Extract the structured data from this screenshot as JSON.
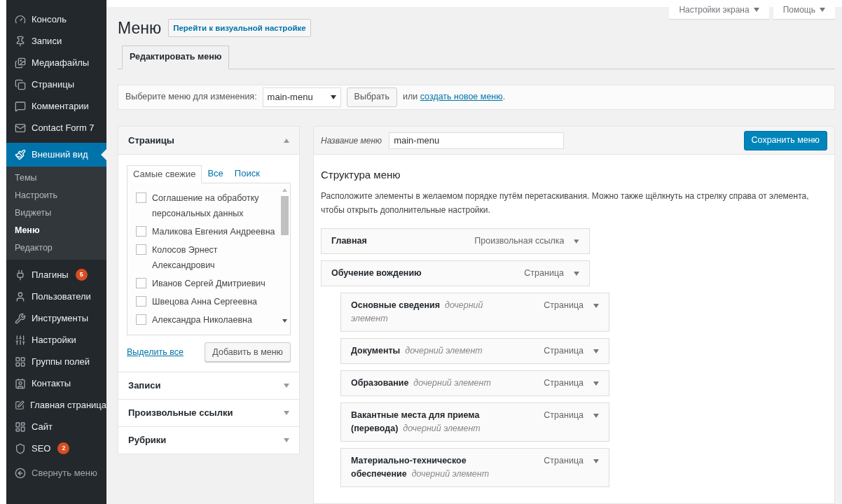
{
  "sidebar": {
    "items": [
      {
        "label": "Консоль",
        "selected": false
      },
      {
        "label": "Записи",
        "selected": false
      },
      {
        "label": "Медиафайлы",
        "selected": false
      },
      {
        "label": "Страницы",
        "selected": false
      },
      {
        "label": "Комментарии",
        "selected": false
      },
      {
        "label": "Contact Form 7",
        "selected": false
      },
      {
        "label": "Внешний вид",
        "selected": true,
        "children": [
          {
            "label": "Темы",
            "selected": false
          },
          {
            "label": "Настроить",
            "selected": false
          },
          {
            "label": "Виджеты",
            "selected": false
          },
          {
            "label": "Меню",
            "selected": true
          },
          {
            "label": "Редактор",
            "selected": false
          }
        ]
      },
      {
        "label": "Плагины",
        "selected": false,
        "badge": "5"
      },
      {
        "label": "Пользователи",
        "selected": false
      },
      {
        "label": "Инструменты",
        "selected": false
      },
      {
        "label": "Настройки",
        "selected": false
      },
      {
        "label": "Группы полей",
        "selected": false
      },
      {
        "label": "Контакты",
        "selected": false
      },
      {
        "label": "Главная страница",
        "selected": false
      },
      {
        "label": "Сайт",
        "selected": false
      },
      {
        "label": "SEO",
        "selected": false,
        "badge": "2"
      }
    ],
    "collapse": "Свернуть меню"
  },
  "top_buttons": [
    "Настройки экрана",
    "Помощь"
  ],
  "page": {
    "title": "Меню",
    "action": "Перейти к визуальной настройке"
  },
  "tabs": [
    {
      "label": "Редактировать меню",
      "selected": true
    }
  ],
  "menu_select": {
    "label": "Выберите меню для изменения:",
    "value": "main-menu",
    "button": "Выбрать",
    "hint_before": "или",
    "link": "создать новое меню",
    "hint_after": "."
  },
  "sections": [
    {
      "title": "Страницы",
      "expanded": true,
      "tabs": [
        {
          "label": "Самые свежие",
          "selected": true
        },
        {
          "label": "Все",
          "selected": false
        },
        {
          "label": "Поиск",
          "selected": false
        }
      ],
      "items": [
        {
          "label": "Соглашение на обработку персональных данных",
          "checked": false
        },
        {
          "label": "Маликова Евгения Андреевна",
          "checked": false
        },
        {
          "label": "Колосов Эрнест Александрович",
          "checked": false
        },
        {
          "label": "Иванов Сергей Дмитриевич",
          "checked": false
        },
        {
          "label": "Швецова Анна Сергеевна",
          "checked": false
        },
        {
          "label": "Александра Николаевна",
          "checked": false
        }
      ],
      "select_all": "Выделить все",
      "add_button": "Добавить в меню"
    },
    {
      "title": "Записи",
      "expanded": false
    },
    {
      "title": "Произвольные ссылки",
      "expanded": false
    },
    {
      "title": "Рубрики",
      "expanded": false
    }
  ],
  "editor": {
    "name_label": "Название меню",
    "name_value": "main-menu",
    "save": "Сохранить меню",
    "heading": "Структура меню",
    "description": "Расположите элементы в желаемом порядке путём перетаскивания. Можно также щёлкнуть на стрелку справа от элемента, чтобы открыть дополнительные настройки.",
    "items": [
      {
        "title": "Главная",
        "type": "Произвольная ссылка"
      },
      {
        "title": "Обучение вождению",
        "type": "Страница",
        "children": [
          {
            "title": "Основные сведения",
            "note": "дочерний элемент",
            "type": "Страница"
          },
          {
            "title": "Документы",
            "note": "дочерний элемент",
            "type": "Страница"
          },
          {
            "title": "Образование",
            "note": "дочерний элемент",
            "type": "Страница"
          },
          {
            "title": "Вакантные места для приема (перевода)",
            "note": "дочерний элемент",
            "type": "Страница"
          },
          {
            "title": "Материально-техническое обеспечение",
            "note": "дочерний элемент",
            "type": "Страница"
          }
        ]
      }
    ]
  }
}
